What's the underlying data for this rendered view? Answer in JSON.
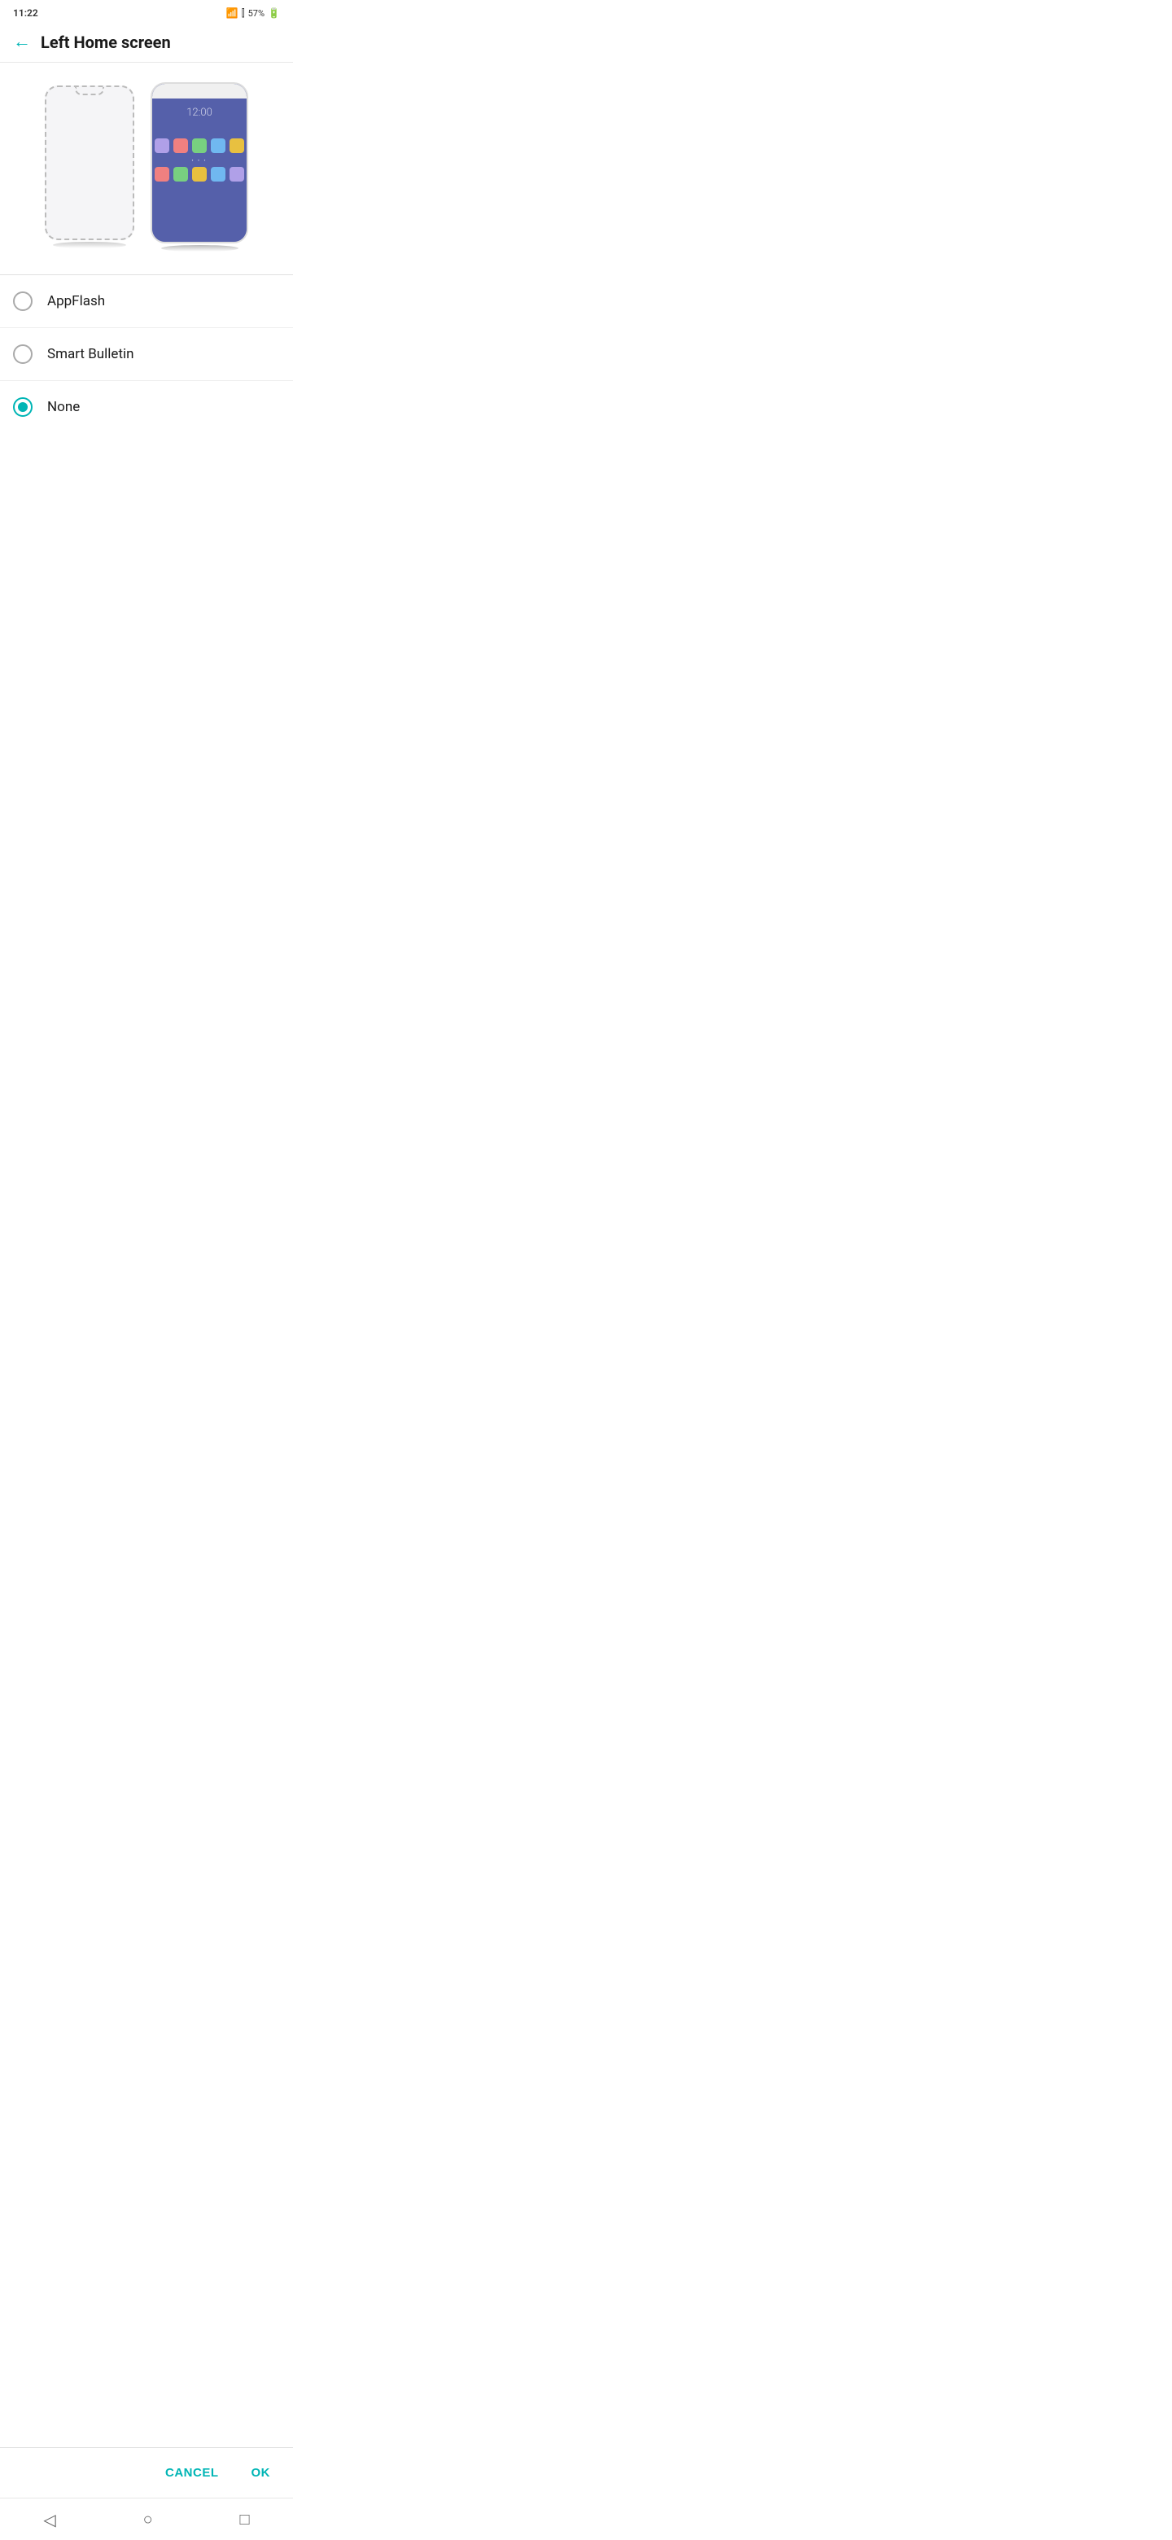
{
  "statusBar": {
    "time": "11:22",
    "battery": "57%"
  },
  "header": {
    "backLabel": "←",
    "title": "Left Home screen"
  },
  "phones": {
    "emptyLabel": "empty-phone",
    "activeLabel": "active-phone",
    "activeTime": "12:00",
    "appRow1Colors": [
      "#b0a0e8",
      "#f08080",
      "#78d080",
      "#70b8f0",
      "#e8c040"
    ],
    "appRow2Colors": [
      "#f08080",
      "#78d080",
      "#e8c040",
      "#70b8f0",
      "#b0a0e8"
    ]
  },
  "options": [
    {
      "id": "appflash",
      "label": "AppFlash",
      "selected": false
    },
    {
      "id": "smartbulletin",
      "label": "Smart Bulletin",
      "selected": false
    },
    {
      "id": "none",
      "label": "None",
      "selected": true
    }
  ],
  "actions": {
    "cancelLabel": "CANCEL",
    "okLabel": "OK"
  },
  "navBar": {
    "backIcon": "◁",
    "homeIcon": "○",
    "recentIcon": "□"
  }
}
